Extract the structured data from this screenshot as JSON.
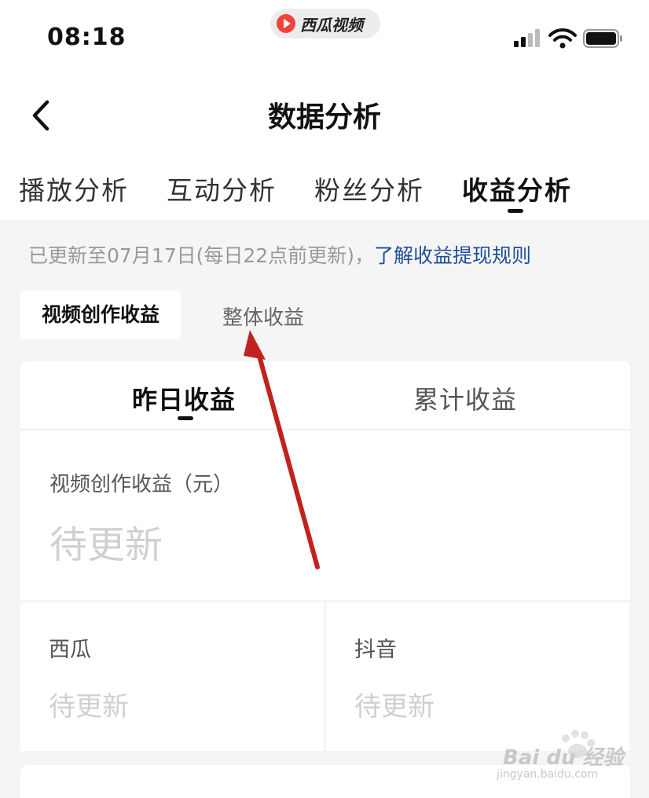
{
  "status_bar": {
    "time": "08:18",
    "app_name": "西瓜视频"
  },
  "nav": {
    "title": "数据分析"
  },
  "tabs": [
    {
      "label": "播放分析",
      "active": false
    },
    {
      "label": "互动分析",
      "active": false
    },
    {
      "label": "粉丝分析",
      "active": false
    },
    {
      "label": "收益分析",
      "active": true
    }
  ],
  "update_notice": {
    "text": "已更新至07月17日(每日22点前更新)，",
    "link": "了解收益提现规则"
  },
  "sub_tabs": {
    "active": "视频创作收益",
    "inactive": "整体收益"
  },
  "card": {
    "tabs": {
      "active": "昨日收益",
      "inactive": "累计收益"
    },
    "main": {
      "label": "视频创作收益（元）",
      "value": "待更新"
    },
    "left": {
      "label": "西瓜",
      "value": "待更新"
    },
    "right": {
      "label": "抖音",
      "value": "待更新"
    }
  },
  "watermark": {
    "text": "Bai du 经验",
    "sub": "jingyan.baidu.com"
  },
  "colors": {
    "link": "#1e4f9c",
    "arrow": "#c0231d",
    "app_logo": "#f0443d",
    "placeholder_value": "#d0d0d0"
  },
  "icons": [
    "back-chevron-icon",
    "signal-icon",
    "wifi-icon",
    "battery-icon",
    "app-logo-icon",
    "paw-icon"
  ]
}
